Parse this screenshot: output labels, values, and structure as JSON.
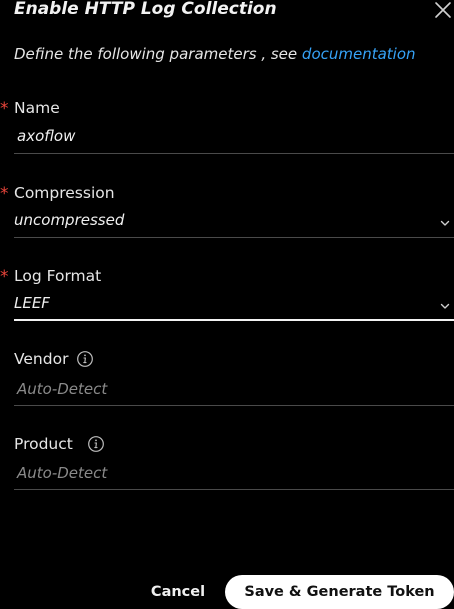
{
  "dialog": {
    "title": "Enable HTTP Log Collection",
    "close_icon": "close-icon",
    "intro_text": "Define the following parameters , see ",
    "intro_link": "documentation"
  },
  "fields": {
    "name": {
      "label": "Name",
      "required": "*",
      "value": "axoflow"
    },
    "compression": {
      "label": "Compression",
      "required": "*",
      "value": "uncompressed"
    },
    "log_format": {
      "label": "Log Format",
      "required": "*",
      "value": "LEEF"
    },
    "vendor": {
      "label": "Vendor",
      "placeholder": "Auto-Detect",
      "icon": "info-icon"
    },
    "product": {
      "label": "Product",
      "placeholder": "Auto-Detect",
      "icon": "info-icon"
    }
  },
  "footer": {
    "cancel_label": "Cancel",
    "save_label": "Save & Generate Token"
  },
  "colors": {
    "background": "#000000",
    "link": "#36a3f7",
    "required": "#e8443a",
    "primary_button": "#ffffff"
  }
}
